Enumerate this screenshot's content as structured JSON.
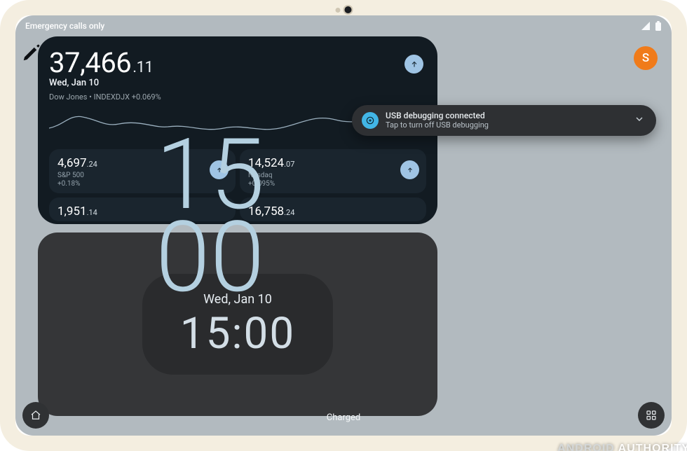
{
  "status": {
    "network": "Emergency calls only"
  },
  "avatar_letter": "S",
  "stocks": {
    "primary": {
      "int": "37,466",
      "dec": ".11",
      "date": "Wed, Jan 10",
      "subline": "Dow Jones • INDEXDJX  +0.069%"
    },
    "minis": [
      {
        "price_int": "4,697",
        "price_dec": ".24",
        "name": "S&P 500",
        "pct": "+0.18%",
        "trend": "up"
      },
      {
        "price_int": "14,524",
        "price_dec": ".07",
        "name": "Nasdaq",
        "pct": "+0.095%",
        "trend": "up"
      },
      {
        "price_int": "1,951",
        "price_dec": ".14",
        "name": "",
        "pct": "",
        "trend": ""
      },
      {
        "price_int": "16,758",
        "price_dec": ".24",
        "name": "",
        "pct": "",
        "trend": ""
      }
    ]
  },
  "clock_widget": {
    "date": "Wed, Jan 10",
    "time": "15:00"
  },
  "lockscreen_clock": {
    "hh": "15",
    "mm": "00"
  },
  "notification": {
    "title": "USB debugging connected",
    "body": "Tap to turn off USB debugging"
  },
  "charged_label": "Charged",
  "watermark": {
    "a": "ANDROID ",
    "b": "AUTHORITY"
  }
}
